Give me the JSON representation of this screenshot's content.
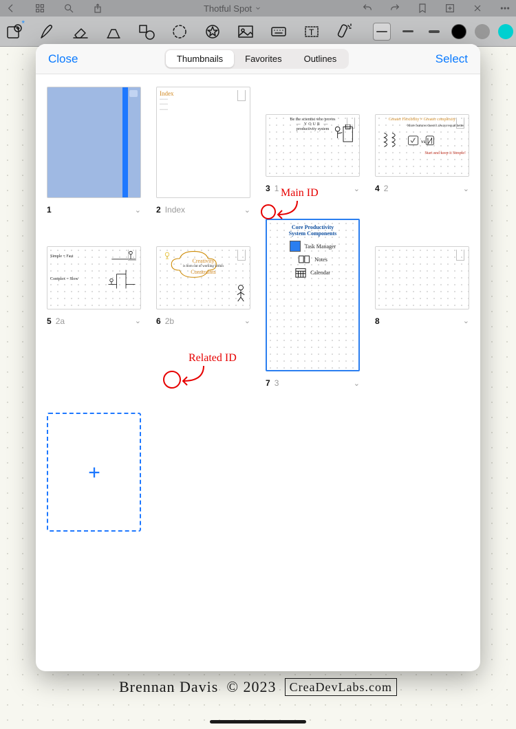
{
  "menubar": {
    "title": "Thotful Spot"
  },
  "sheet": {
    "close": "Close",
    "select": "Select",
    "segments": {
      "thumbnails": "Thumbnails",
      "favorites": "Favorites",
      "outlines": "Outlines"
    }
  },
  "pages": [
    {
      "num": "1",
      "sec": ""
    },
    {
      "num": "2",
      "sec": "Index"
    },
    {
      "num": "3",
      "sec": "1"
    },
    {
      "num": "4",
      "sec": "2"
    },
    {
      "num": "5",
      "sec": "2a"
    },
    {
      "num": "6",
      "sec": "2b"
    },
    {
      "num": "7",
      "sec": "3"
    },
    {
      "num": "8",
      "sec": ""
    }
  ],
  "thumbs": {
    "index_title": "Index",
    "p3_line1": "Be the scientist who proves",
    "p3_line2": "YOUR",
    "p3_line3": "productivity system",
    "p4_line1": "Greater Flexibility ≠ Greater complexity",
    "p4_line2": "More features doesn't always equal better",
    "p4_line3": "Start and keep it Simple!",
    "p5_line1": "Simple = Fast",
    "p5_line2": "Complex = Slow",
    "p6_line1": "Creativity",
    "p6_line2": "is born out of working within",
    "p6_line3": "Constraints",
    "p7_title1": "Core Productivity",
    "p7_title2": "System Components",
    "p7_item1": "Task Manager",
    "p7_item2": "Notes",
    "p7_item3": "Calendar"
  },
  "annotations": {
    "main_id": "Main ID",
    "related_id": "Related ID"
  },
  "footer": {
    "name": "Brennan Davis",
    "year": "© 2023",
    "site": "CreaDevLabs.com"
  }
}
